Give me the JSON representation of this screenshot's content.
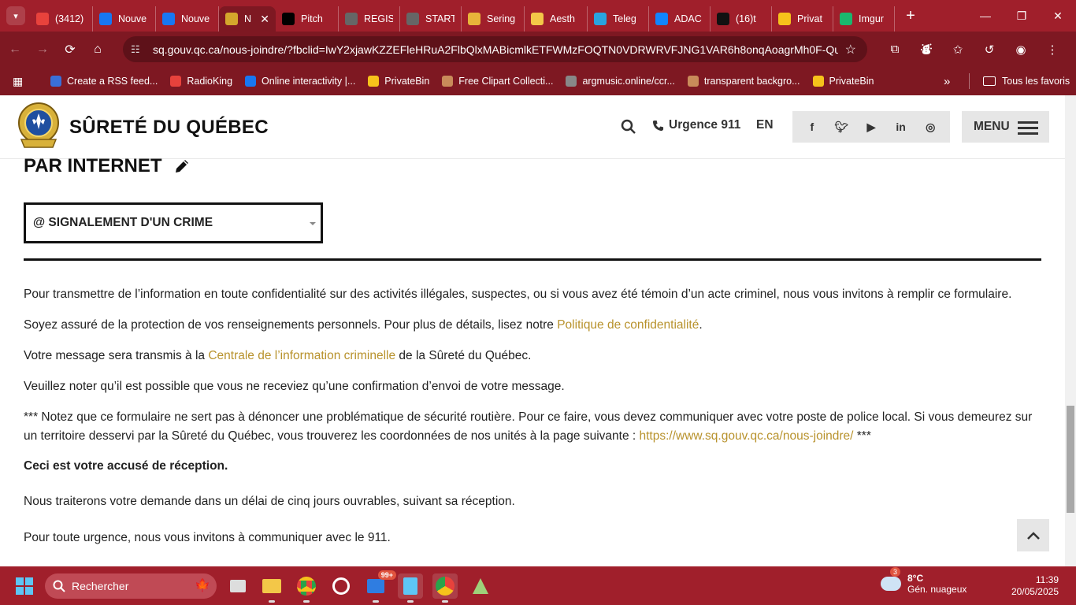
{
  "browser": {
    "tabs": [
      {
        "title": "(3412)",
        "icon": "badge-icon",
        "color": "#e8423c"
      },
      {
        "title": "Nouve",
        "icon": "facebook-icon",
        "color": "#1877f2"
      },
      {
        "title": "Nouve",
        "icon": "facebook-icon",
        "color": "#1877f2"
      },
      {
        "title": "N",
        "icon": "police-badge-icon",
        "color": "#d4a72c",
        "active": true
      },
      {
        "title": "Pitch",
        "icon": "x-icon",
        "color": "#000000"
      },
      {
        "title": "REGIS",
        "icon": "check-circle-icon",
        "color": "#666666"
      },
      {
        "title": "START",
        "icon": "check-circle-icon",
        "color": "#666666"
      },
      {
        "title": "Sering",
        "icon": "sering-icon",
        "color": "#e8b43a"
      },
      {
        "title": "Aesth",
        "icon": "folder-icon",
        "color": "#f3c748"
      },
      {
        "title": "Teleg",
        "icon": "telegram-icon",
        "color": "#2aa3df"
      },
      {
        "title": "ADAC",
        "icon": "butterfly-icon",
        "color": "#1185fe"
      },
      {
        "title": "(16)t",
        "icon": "tiktok-icon",
        "color": "#111111"
      },
      {
        "title": "Privat",
        "icon": "privatebin-icon",
        "color": "#f6c21b"
      },
      {
        "title": "Imgur",
        "icon": "imgur-icon",
        "color": "#1bb76e"
      }
    ],
    "url": "sq.gouv.qc.ca/nous-joindre/?fbclid=IwY2xjawKZZEFleHRuA2FlbQlxMABicmlkETFWMzFOQTN0VDRWRVFJNG1VAR6h8onqAoagrMh0F-Quy...",
    "bookmarks": [
      {
        "label": "Create a RSS feed...",
        "color": "#3a6fd8"
      },
      {
        "label": "RadioKing",
        "color": "#e8423c"
      },
      {
        "label": "Online interactivity |...",
        "color": "#1877f2"
      },
      {
        "label": "PrivateBin",
        "color": "#f6c21b"
      },
      {
        "label": "Free Clipart Collecti...",
        "color": "#c98b5a"
      },
      {
        "label": "argmusic.online/ccr...",
        "color": "#888888"
      },
      {
        "label": "transparent backgro...",
        "color": "#c98b5a"
      },
      {
        "label": "PrivateBin",
        "color": "#f6c21b"
      }
    ],
    "all_bookmarks": "Tous les favoris"
  },
  "site": {
    "name": "SÛRETÉ DU QUÉBEC",
    "phone": "Urgence 911",
    "lang": "EN",
    "menu": "MENU"
  },
  "content": {
    "section_title": "PAR INTERNET",
    "select_value": "@ SIGNALEMENT D'UN CRIME",
    "p1": "Pour transmettre de l’information en toute confidentialité sur des activités illégales, suspectes, ou si vous avez été témoin d’un acte criminel, nous vous invitons à remplir ce formulaire.",
    "p2_before": "Soyez assuré de la protection de vos renseignements personnels. Pour plus de détails, lisez notre ",
    "p2_link": "Politique de confidentialité",
    "p2_after": ".",
    "p3_before": "Votre message sera transmis à la ",
    "p3_link": "Centrale de l’information criminelle",
    "p3_after": " de la Sûreté du Québec.",
    "p4": "Veuillez noter qu’il est possible que vous ne receviez qu’une confirmation d’envoi de votre message.",
    "p5_before": "*** Notez que ce formulaire ne sert pas à dénoncer une problématique de sécurité routière. Pour ce faire, vous devez communiquer avec votre poste de police local. Si vous demeurez sur un territoire desservi par la Sûreté du Québec, vous trouverez les coordonnées de nos unités à la page suivante : ",
    "p5_link": "https://www.sq.gouv.qc.ca/nous-joindre/",
    "p5_after": " ***",
    "p6": "Ceci est votre accusé de réception.",
    "p7": "Nous traiterons votre demande dans un délai de cinq jours ouvrables, suivant sa réception.",
    "p8": "Pour toute urgence, nous vous invitons à communiquer avec le 911."
  },
  "taskbar": {
    "search": "Rechercher",
    "mail_badge": "99+",
    "weather_badge": "3",
    "temp": "8°C",
    "weather": "Gén. nuageux",
    "time": "11:39",
    "date": "20/05/2025"
  },
  "colors": {
    "chrome": "#a01f2b",
    "link": "#b8922c"
  }
}
